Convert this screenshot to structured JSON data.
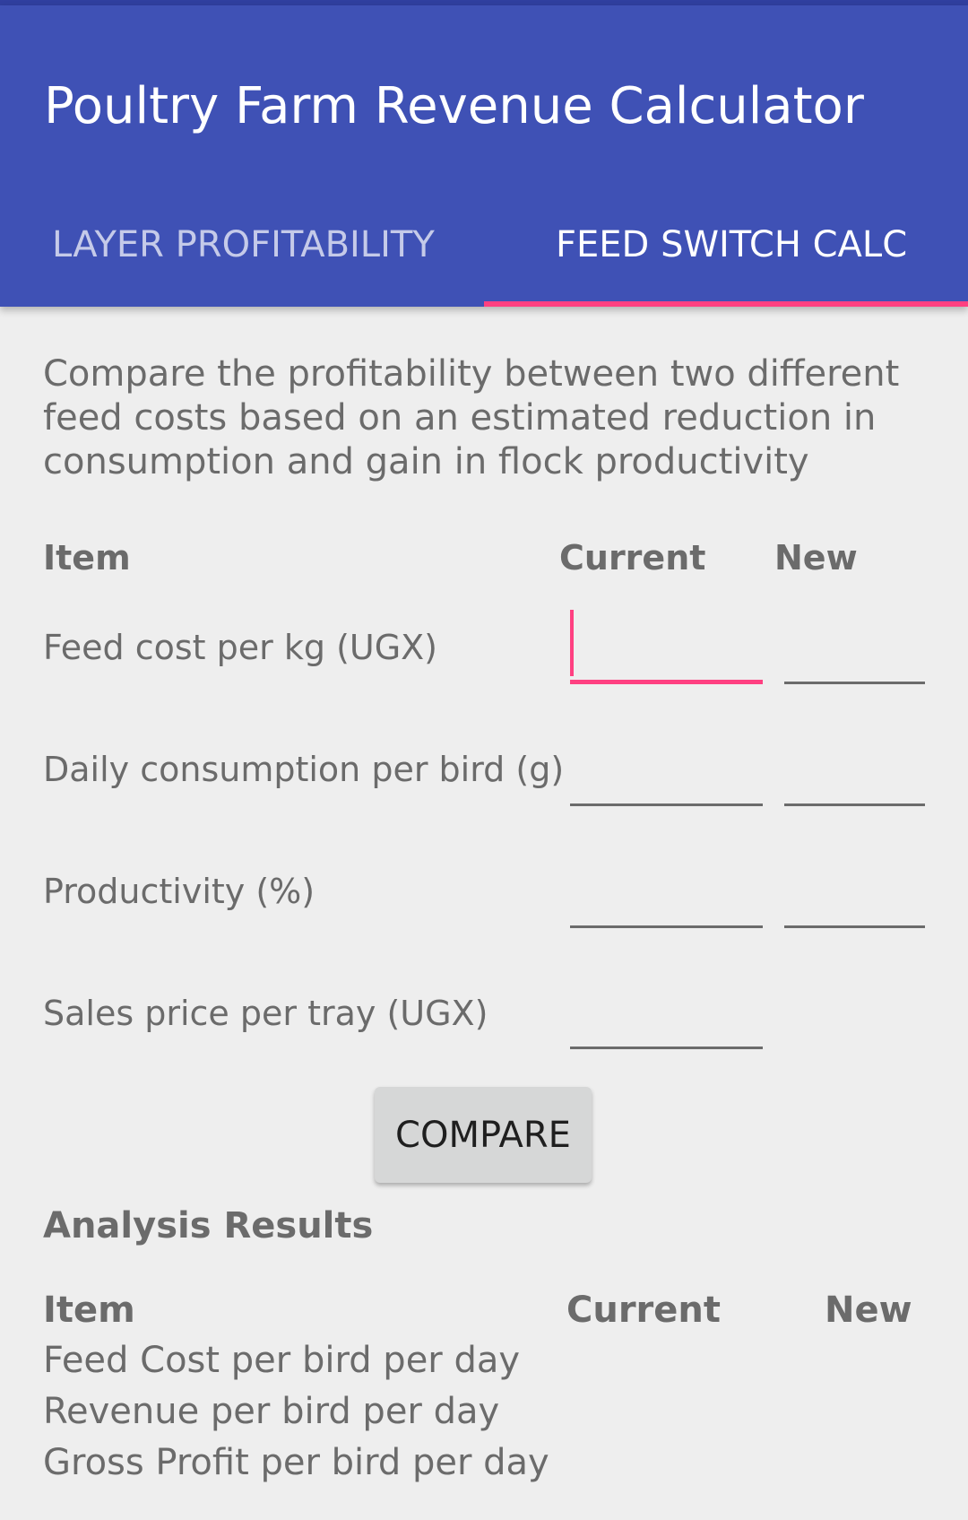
{
  "app": {
    "title": "Poultry Farm Revenue Calculator",
    "accent_color": "#ff4081",
    "primary_color": "#3f51b5"
  },
  "tabs": [
    {
      "label": "LAYER PROFITABILITY",
      "selected": false
    },
    {
      "label": "FEED SWITCH CALC",
      "selected": true
    }
  ],
  "description": "Compare the profitability between two different feed costs based on an estimated reduction in consumption and gain in flock productivity",
  "inputs": {
    "headers": {
      "item": "Item",
      "current": "Current",
      "new": "New"
    },
    "rows": [
      {
        "label": "Feed cost per kg (UGX)",
        "current_value": "",
        "new_value": "",
        "focused": "current"
      },
      {
        "label": "Daily consumption per bird (g)",
        "current_value": "",
        "new_value": ""
      },
      {
        "label": "Productivity (%)",
        "current_value": "",
        "new_value": ""
      },
      {
        "label": "Sales price per tray (UGX)",
        "current_value": ""
      }
    ]
  },
  "compare_button": "COMPARE",
  "results": {
    "title": "Analysis Results",
    "headers": {
      "item": "Item",
      "current": "Current",
      "new": "New"
    },
    "rows": [
      {
        "label": "Feed Cost per bird per day",
        "current": "",
        "new": ""
      },
      {
        "label": "Revenue per bird per day",
        "current": "",
        "new": ""
      },
      {
        "label": "Gross Profit per bird per day",
        "current": "",
        "new": ""
      }
    ]
  }
}
